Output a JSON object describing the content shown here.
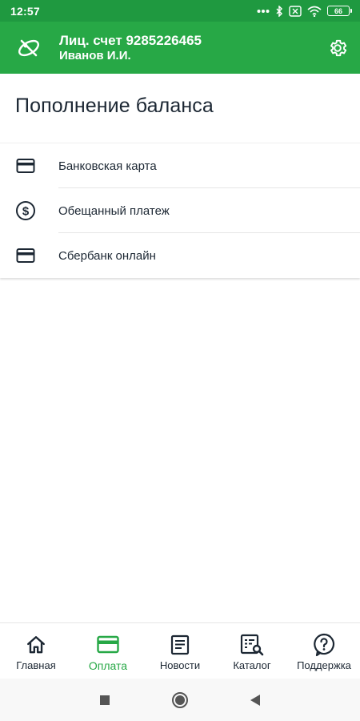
{
  "status_bar": {
    "time": "12:57",
    "battery": "66",
    "icons": [
      "dots-icon",
      "bluetooth-icon",
      "sim-off-icon",
      "wifi-icon",
      "battery-icon"
    ]
  },
  "header": {
    "logo_icon": "operator-logo-icon",
    "account_line": "Лиц. счет 9285226465",
    "user_name": "Иванов И.И.",
    "settings_icon": "gear-icon"
  },
  "main": {
    "title": "Пополнение баланса",
    "options": [
      {
        "label": "Банковская карта",
        "icon": "credit-card-icon"
      },
      {
        "label": "Обещанный платеж",
        "icon": "dollar-circle-icon"
      },
      {
        "label": "Сбербанк онлайн",
        "icon": "credit-card-icon"
      }
    ]
  },
  "bottom_nav": {
    "items": [
      {
        "label": "Главная",
        "icon": "home-icon"
      },
      {
        "label": "Оплата",
        "icon": "credit-card-icon",
        "active": true
      },
      {
        "label": "Новости",
        "icon": "news-icon"
      },
      {
        "label": "Каталог",
        "icon": "catalog-search-icon"
      },
      {
        "label": "Поддержка",
        "icon": "help-icon"
      }
    ]
  },
  "system_nav": [
    "recents-icon",
    "home-circle-icon",
    "back-icon"
  ],
  "colors": {
    "status_bar": "#1f9940",
    "app_bar": "#27a846",
    "accent": "#27a846",
    "text_dark": "#1c2733"
  }
}
